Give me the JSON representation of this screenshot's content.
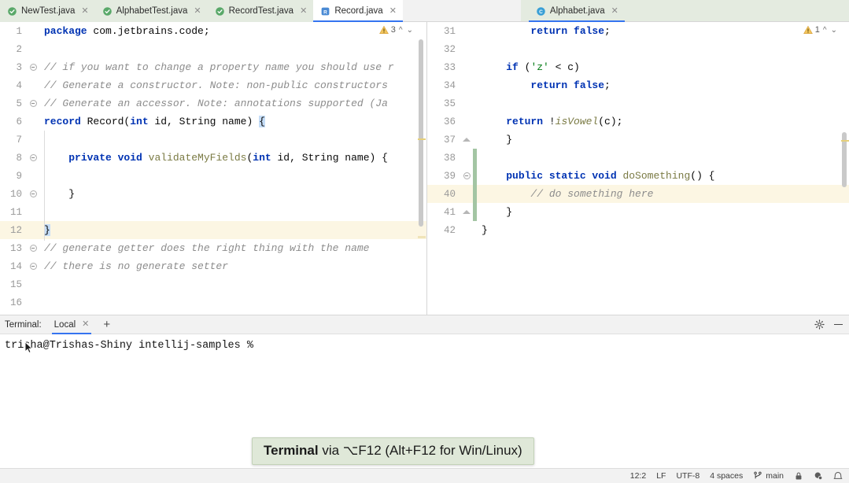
{
  "tabs": [
    {
      "label": "NewTest.java",
      "icon": "java-test-class-icon",
      "state": "test",
      "closeable": true
    },
    {
      "label": "AlphabetTest.java",
      "icon": "java-test-class-icon",
      "state": "test",
      "closeable": true
    },
    {
      "label": "RecordTest.java",
      "icon": "java-test-class-icon",
      "state": "test",
      "closeable": true
    },
    {
      "label": "Record.java",
      "icon": "java-record-icon",
      "state": "active-left",
      "closeable": true
    },
    {
      "label": "Alphabet.java",
      "icon": "java-class-icon",
      "state": "active-right",
      "closeable": true
    }
  ],
  "left_editor": {
    "inspection": {
      "count": "3",
      "icon": "warning-triangle-icon"
    },
    "lines": [
      {
        "num": "1",
        "fold": "",
        "indent": 0,
        "caret": false,
        "tokens": [
          {
            "t": "package ",
            "c": "kw"
          },
          {
            "t": "com.jetbrains.code;",
            "c": "plain"
          }
        ]
      },
      {
        "num": "2",
        "fold": "",
        "indent": 0,
        "caret": false,
        "tokens": []
      },
      {
        "num": "3",
        "fold": "minus",
        "indent": 0,
        "caret": false,
        "tokens": [
          {
            "t": "// if you want to change a property name you should use r",
            "c": "cmt"
          }
        ]
      },
      {
        "num": "4",
        "fold": "",
        "indent": 0,
        "caret": false,
        "tokens": [
          {
            "t": "// Generate a constructor. Note: non-public constructors",
            "c": "cmt"
          }
        ]
      },
      {
        "num": "5",
        "fold": "minus",
        "indent": 0,
        "caret": false,
        "tokens": [
          {
            "t": "// Generate an accessor. Note: annotations supported (Ja",
            "c": "cmt"
          }
        ]
      },
      {
        "num": "6",
        "fold": "",
        "indent": 0,
        "caret": false,
        "tokens": [
          {
            "t": "record ",
            "c": "kw"
          },
          {
            "t": "Record(",
            "c": "plain"
          },
          {
            "t": "int",
            "c": "kw"
          },
          {
            "t": " id, String name) ",
            "c": "plain"
          },
          {
            "t": "{",
            "c": "brace"
          }
        ]
      },
      {
        "num": "7",
        "fold": "",
        "indent": 1,
        "caret": false,
        "tokens": []
      },
      {
        "num": "8",
        "fold": "minus",
        "indent": 1,
        "caret": false,
        "tokens": [
          {
            "t": "    ",
            "c": "plain"
          },
          {
            "t": "private void ",
            "c": "kw"
          },
          {
            "t": "validateMyFields",
            "c": "meth"
          },
          {
            "t": "(",
            "c": "plain"
          },
          {
            "t": "int",
            "c": "kw"
          },
          {
            "t": " id, String name) {",
            "c": "plain"
          }
        ]
      },
      {
        "num": "9",
        "fold": "",
        "indent": 1,
        "caret": false,
        "tokens": []
      },
      {
        "num": "10",
        "fold": "minus",
        "indent": 1,
        "caret": false,
        "tokens": [
          {
            "t": "    }",
            "c": "plain"
          }
        ]
      },
      {
        "num": "11",
        "fold": "",
        "indent": 1,
        "caret": false,
        "tokens": []
      },
      {
        "num": "12",
        "fold": "",
        "indent": 0,
        "caret": true,
        "tokens": [
          {
            "t": "}",
            "c": "brace"
          }
        ]
      },
      {
        "num": "13",
        "fold": "minus",
        "indent": 0,
        "caret": false,
        "tokens": [
          {
            "t": "// generate getter does the right thing with the name",
            "c": "cmt"
          }
        ]
      },
      {
        "num": "14",
        "fold": "minus",
        "indent": 0,
        "caret": false,
        "tokens": [
          {
            "t": "// there is no generate setter",
            "c": "cmt"
          }
        ]
      },
      {
        "num": "15",
        "fold": "",
        "indent": 0,
        "caret": false,
        "tokens": []
      },
      {
        "num": "16",
        "fold": "",
        "indent": 0,
        "caret": false,
        "tokens": []
      }
    ]
  },
  "right_editor": {
    "inspection": {
      "count": "1",
      "icon": "warning-triangle-icon"
    },
    "lines": [
      {
        "num": "31",
        "fold": "",
        "vcs": false,
        "caret": false,
        "tokens": [
          {
            "t": "        ",
            "c": "plain"
          },
          {
            "t": "return false",
            "c": "kw"
          },
          {
            "t": ";",
            "c": "plain"
          }
        ]
      },
      {
        "num": "32",
        "fold": "",
        "vcs": false,
        "caret": false,
        "tokens": []
      },
      {
        "num": "33",
        "fold": "",
        "vcs": false,
        "caret": false,
        "tokens": [
          {
            "t": "    ",
            "c": "plain"
          },
          {
            "t": "if",
            "c": "kw"
          },
          {
            "t": " (",
            "c": "plain"
          },
          {
            "t": "'z'",
            "c": "str"
          },
          {
            "t": " < c)",
            "c": "plain"
          }
        ]
      },
      {
        "num": "34",
        "fold": "",
        "vcs": false,
        "caret": false,
        "tokens": [
          {
            "t": "        ",
            "c": "plain"
          },
          {
            "t": "return false",
            "c": "kw"
          },
          {
            "t": ";",
            "c": "plain"
          }
        ]
      },
      {
        "num": "35",
        "fold": "",
        "vcs": false,
        "caret": false,
        "tokens": []
      },
      {
        "num": "36",
        "fold": "",
        "vcs": false,
        "caret": false,
        "tokens": [
          {
            "t": "    ",
            "c": "plain"
          },
          {
            "t": "return",
            "c": "kw"
          },
          {
            "t": " !",
            "c": "plain"
          },
          {
            "t": "isVowel",
            "c": "methi"
          },
          {
            "t": "(c);",
            "c": "plain"
          }
        ]
      },
      {
        "num": "37",
        "fold": "up",
        "vcs": false,
        "caret": false,
        "tokens": [
          {
            "t": "    }",
            "c": "plain"
          }
        ]
      },
      {
        "num": "38",
        "fold": "",
        "vcs": true,
        "caret": false,
        "tokens": []
      },
      {
        "num": "39",
        "fold": "minus",
        "vcs": true,
        "caret": false,
        "tokens": [
          {
            "t": "    ",
            "c": "plain"
          },
          {
            "t": "public static void ",
            "c": "kw"
          },
          {
            "t": "doSomething",
            "c": "meth"
          },
          {
            "t": "() {",
            "c": "plain"
          }
        ]
      },
      {
        "num": "40",
        "fold": "",
        "vcs": true,
        "caret": true,
        "tokens": [
          {
            "t": "        ",
            "c": "plain"
          },
          {
            "t": "// do something here",
            "c": "cmt"
          }
        ]
      },
      {
        "num": "41",
        "fold": "up",
        "vcs": true,
        "caret": false,
        "tokens": [
          {
            "t": "    }",
            "c": "plain"
          }
        ]
      },
      {
        "num": "42",
        "fold": "",
        "vcs": false,
        "caret": false,
        "tokens": [
          {
            "t": "}",
            "c": "plain"
          }
        ]
      }
    ]
  },
  "terminal": {
    "label": "Terminal:",
    "tab": "Local",
    "add_button": "+",
    "settings_icon": "gear-icon",
    "minimize_icon": "minimize-icon",
    "prompt": "trisha@Trishas-Shiny intellij-samples %"
  },
  "tooltip": {
    "title": "Terminal",
    "rest": " via ⌥F12 (Alt+F12 for Win/Linux)"
  },
  "statusbar": {
    "caret_position": "12:2",
    "line_separator": "LF",
    "encoding": "UTF-8",
    "indent": "4 spaces",
    "branch": "main",
    "branch_icon": "git-branch-icon",
    "lock_icon": "lock-icon",
    "inspections_icon": "inspections-eye-icon",
    "notifications_icon": "notifications-bell-icon"
  },
  "colors": {
    "accent_blue": "#3574f0",
    "test_tab_green": "#e4ebe0",
    "caret_line": "#fcf6e3",
    "vcs_green": "#a3c5a3",
    "keyword": "#0033b3",
    "comment": "#8c8c8c",
    "string": "#067d17",
    "tooltip_bg": "#dfe8d8"
  }
}
